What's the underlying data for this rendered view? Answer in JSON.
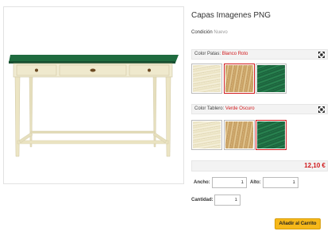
{
  "product": {
    "title": "Capas Imagenes PNG",
    "condition_label": "Condición",
    "condition_value": "Nuevo",
    "image_icon": "console-table-image"
  },
  "options": [
    {
      "label": "Color Patas:",
      "selected": "Blanco Roto",
      "expand_icon": "expand-arrows-icon",
      "swatches": [
        {
          "name": "blanco-roto",
          "texture": "wood-white"
        },
        {
          "name": "pino",
          "texture": "wood-pine"
        },
        {
          "name": "verde-oscuro",
          "texture": "wood-green"
        }
      ]
    },
    {
      "label": "Color Tablero:",
      "selected": "Verde Oscuro",
      "expand_icon": "expand-arrows-icon",
      "swatches": [
        {
          "name": "blanco-roto",
          "texture": "wood-white"
        },
        {
          "name": "pino",
          "texture": "wood-pine"
        },
        {
          "name": "verde-oscuro",
          "texture": "wood-green"
        }
      ]
    }
  ],
  "price": "12,10 €",
  "dimensions": {
    "width_label": "Ancho:",
    "width_value": "1",
    "height_label": "Alto:",
    "height_value": "1"
  },
  "quantity": {
    "label": "Cantidad:",
    "value": "1"
  },
  "add_to_cart_label": "Añadir al Carrito",
  "colors": {
    "accent_red": "#d0181b",
    "cart_button": "#f6b81a",
    "table_top_green": "#1f6b3f",
    "table_body_cream": "#f1ecd3"
  }
}
